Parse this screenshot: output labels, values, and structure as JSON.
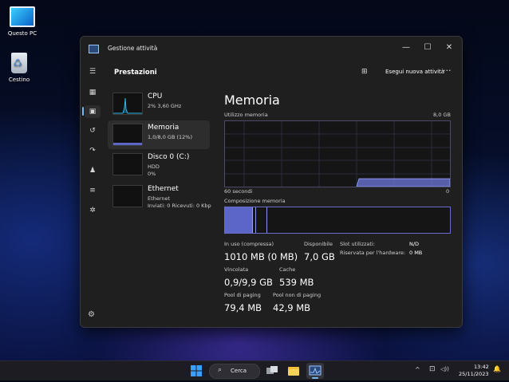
{
  "desktop": {
    "icons": [
      {
        "label": "Questo PC",
        "icon": "computer-icon"
      },
      {
        "label": "Cestino",
        "icon": "recycle-bin-icon"
      }
    ]
  },
  "window": {
    "title": "Gestione attività",
    "controls": {
      "minimize": "—",
      "maximize": "☐",
      "close": "✕"
    }
  },
  "header": {
    "title": "Prestazioni",
    "run_task": "Esegui nuova attività",
    "more": "···"
  },
  "sidebar": {
    "items": [
      "menu-icon",
      "processes-icon",
      "performance-icon",
      "app-history-icon",
      "startup-apps-icon",
      "users-icon",
      "details-icon",
      "services-icon",
      "settings-icon"
    ]
  },
  "perf_list": [
    {
      "name": "CPU",
      "sub1": "2% 3,60 GHz",
      "sub2": ""
    },
    {
      "name": "Memoria",
      "sub1": "1,0/8,0 GB (12%)",
      "sub2": ""
    },
    {
      "name": "Disco 0 (C:)",
      "sub1": "HDD",
      "sub2": "0%"
    },
    {
      "name": "Ethernet",
      "sub1": "Ethernet",
      "sub2": "Inviati: 0 Ricevuti: 0 Kbp"
    }
  ],
  "detail": {
    "title": "Memoria",
    "usage_label": "Utilizzo memoria",
    "max_label": "8,0 GB",
    "time_label": "60 secondi",
    "zero_label": "0",
    "composition_label": "Composizione memoria",
    "usage_fraction": 0.12,
    "stats": {
      "in_use_label": "In uso (compressa)",
      "in_use_value": "1010 MB (0 MB)",
      "available_label": "Disponibile",
      "available_value": "7,0 GB",
      "slots_label": "Slot utilizzati:",
      "slots_value": "N/D",
      "reserved_label": "Riservata per l'hardware:",
      "reserved_value": "0 MB",
      "committed_label": "Vincolata",
      "committed_value": "0,9/9,9 GB",
      "cache_label": "Cache",
      "cache_value": "539 MB",
      "paged_label": "Pool di paging",
      "paged_value": "79,4 MB",
      "nonpaged_label": "Pool non di paging",
      "nonpaged_value": "42,9 MB"
    }
  },
  "taskbar": {
    "search_label": "Cerca",
    "time": "13:42",
    "date": "25/11/2023",
    "tray": {
      "chevron": "^",
      "network": "⊡",
      "volume": "◁))",
      "bell": "🔔"
    }
  },
  "colors": {
    "accent": "#7f8cf0",
    "cpu_graph": "#2fb6e8",
    "window_bg": "#1f1f1f"
  }
}
